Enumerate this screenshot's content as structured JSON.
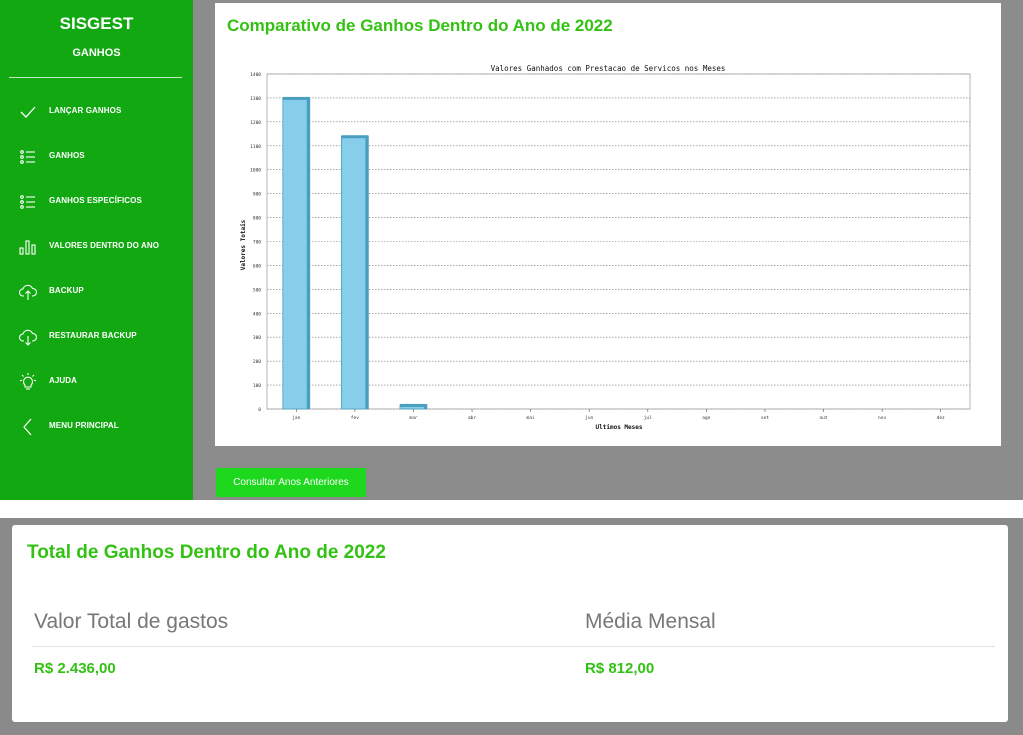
{
  "sidebar": {
    "brand": "SISGEST",
    "section": "GANHOS",
    "items": [
      {
        "label": "LANÇAR GANHOS",
        "icon": "check-icon"
      },
      {
        "label": "GANHOS",
        "icon": "list-icon"
      },
      {
        "label": "GANHOS ESPECÍFICOS",
        "icon": "list-icon"
      },
      {
        "label": "VALORES DENTRO DO ANO",
        "icon": "bar-chart-icon"
      },
      {
        "label": "BACKUP",
        "icon": "cloud-upload-icon"
      },
      {
        "label": "RESTAURAR BACKUP",
        "icon": "cloud-download-icon"
      },
      {
        "label": "AJUDA",
        "icon": "lightbulb-icon"
      },
      {
        "label": "MENU PRINCIPAL",
        "icon": "chevron-left-icon"
      }
    ]
  },
  "card": {
    "title": "Comparativo de Ganhos Dentro do Ano de 2022"
  },
  "button": {
    "label": "Consultar Anos Anteriores"
  },
  "totals": {
    "title": "Total de Ganhos Dentro do Ano de 2022",
    "total_label": "Valor Total de gastos",
    "total_value": "R$ 2.436,00",
    "avg_label": "Média Mensal",
    "avg_value": "R$ 812,00"
  },
  "colors": {
    "sidebar": "#12a812",
    "accent": "#33c214",
    "button": "#1ed81e",
    "bar": "#87ceeb",
    "bar_edge": "#4a9fc0"
  },
  "chart_data": {
    "type": "bar",
    "title": "Valores Ganhados com Prestacao de Servicos nos Meses",
    "xlabel": "Ultimos Meses",
    "ylabel": "Valores Totais",
    "categories": [
      "jan",
      "fev",
      "mar",
      "abr",
      "mai",
      "jun",
      "jul",
      "ago",
      "set",
      "out",
      "nov",
      "dez"
    ],
    "values": [
      1300,
      1140,
      17,
      0,
      0,
      0,
      0,
      0,
      0,
      0,
      0,
      0
    ],
    "ylim": [
      0,
      1400
    ],
    "yticks": [
      0,
      100,
      200,
      300,
      400,
      500,
      600,
      700,
      800,
      900,
      1000,
      1100,
      1200,
      1300,
      1400
    ],
    "grid": true
  }
}
